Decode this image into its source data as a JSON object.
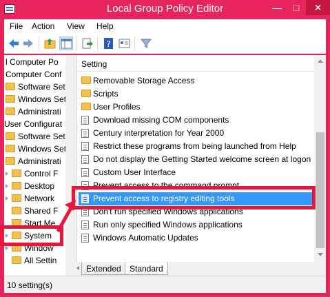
{
  "window": {
    "title": "Local Group Policy Editor",
    "controls": {
      "minimize": "—",
      "maximize": "□",
      "close": "✕"
    }
  },
  "menu": [
    "File",
    "Action",
    "View",
    "Help"
  ],
  "toolbar": {
    "icons": [
      "back-arrow-icon",
      "forward-arrow-icon",
      "up-folder-icon",
      "show-hide-tree-icon",
      "export-list-icon",
      "help-icon",
      "properties-icon",
      "filter-icon"
    ]
  },
  "tree": {
    "items": [
      "l Computer Po",
      "Computer Conf",
      "Software Set",
      "Windows Set",
      "Administrati",
      "User Configurat",
      "Software Set",
      "Windows Set",
      "Administrati",
      "Control F",
      "Desktop",
      "Network",
      "Shared F",
      "Start Me",
      "System",
      "Window",
      "All Settin"
    ]
  },
  "list": {
    "column_header": "Setting",
    "rows": [
      {
        "label": "Removable Storage Access",
        "type": "folder"
      },
      {
        "label": "Scripts",
        "type": "folder"
      },
      {
        "label": "User Profiles",
        "type": "folder"
      },
      {
        "label": "Download missing COM components",
        "type": "setting"
      },
      {
        "label": "Century interpretation for Year 2000",
        "type": "setting"
      },
      {
        "label": "Restrict these programs from being launched from Help",
        "type": "setting"
      },
      {
        "label": "Do not display the Getting Started welcome screen at logon",
        "type": "setting"
      },
      {
        "label": "Custom User Interface",
        "type": "setting"
      },
      {
        "label": "Prevent access to the command prompt",
        "type": "setting"
      },
      {
        "label": "Prevent access to registry editing tools",
        "type": "setting",
        "selected": true
      },
      {
        "label": "Don't run specified Windows applications",
        "type": "setting"
      },
      {
        "label": "Run only specified Windows applications",
        "type": "setting"
      },
      {
        "label": "Windows Automatic Updates",
        "type": "setting"
      }
    ]
  },
  "tabs": [
    "Extended",
    "Standard"
  ],
  "active_tab": "Standard",
  "status": "10 setting(s)",
  "colors": {
    "title_bar": "#e8245e",
    "selection": "#3399ff",
    "highlight_box": "#e6163c"
  }
}
